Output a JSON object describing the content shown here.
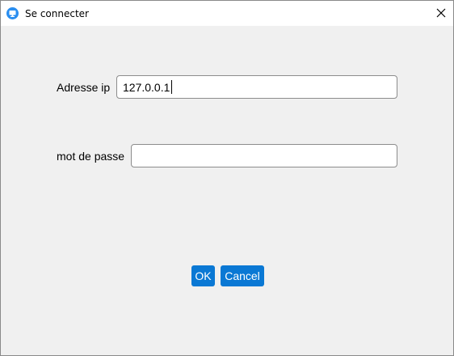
{
  "window": {
    "title": "Se connecter",
    "icon": "monitor-app-icon",
    "close_icon": "close-icon"
  },
  "form": {
    "ip_label": "Adresse ip",
    "ip_value": "127.0.0.1",
    "password_label": "mot de passe",
    "password_value": ""
  },
  "buttons": {
    "ok_label": "OK",
    "cancel_label": "Cancel"
  },
  "colors": {
    "button_bg": "#0a78d4",
    "window_bg": "#f0f0f0",
    "app_icon": "#1e90ff"
  }
}
